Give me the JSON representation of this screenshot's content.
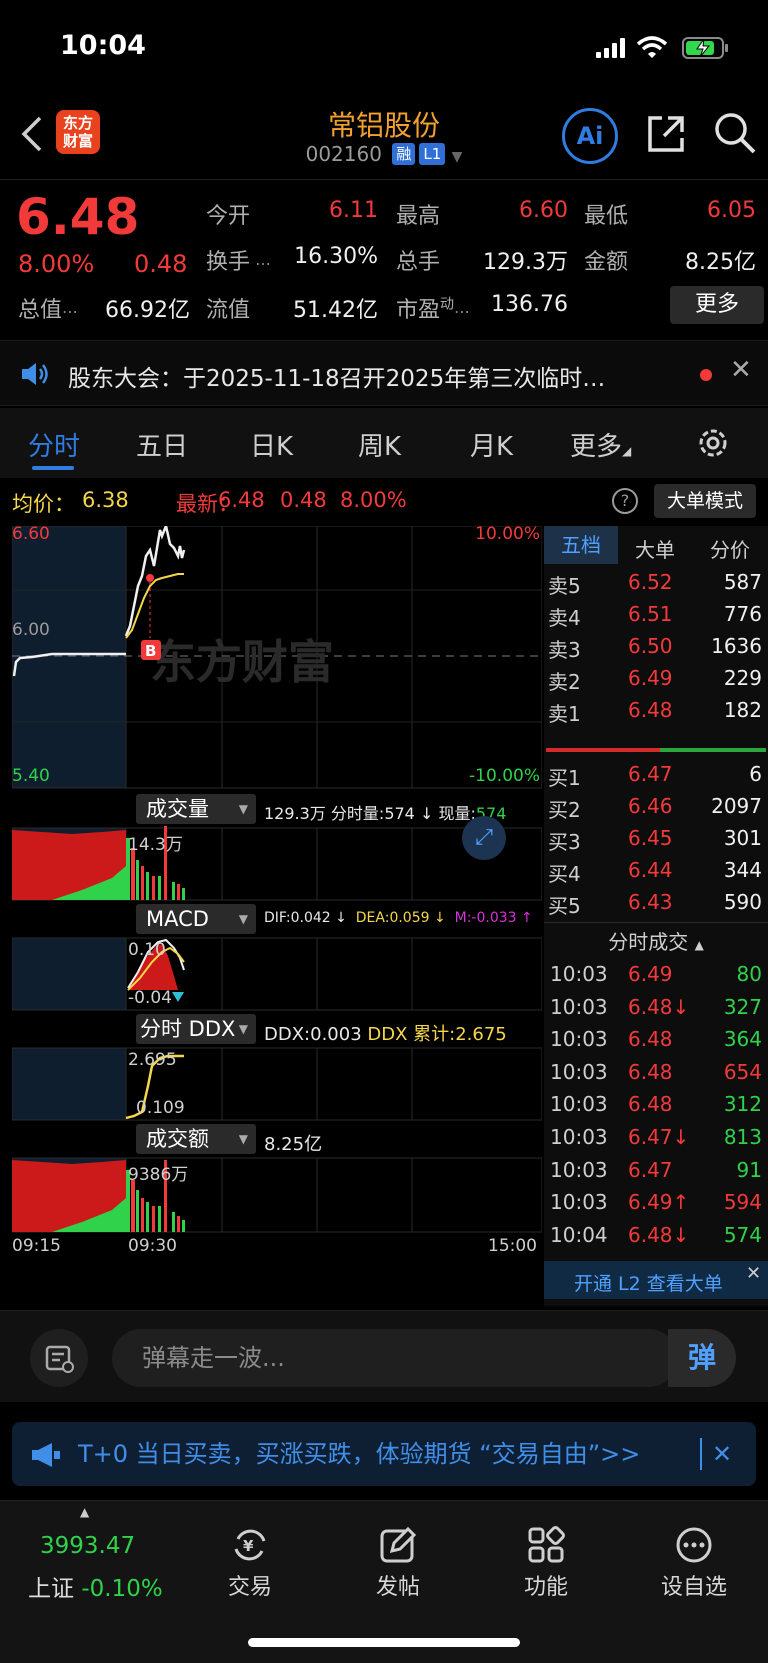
{
  "status_bar": {
    "time": "10:04"
  },
  "nav": {
    "logo_text": "东方财富",
    "stock_name": "常铝股份",
    "stock_code": "002160",
    "tag_margin": "融",
    "tag_level": "L1",
    "ai_label": "Ai"
  },
  "quote": {
    "price": "6.48",
    "change_pct": "8.00%",
    "change": "0.48",
    "open_label": "今开",
    "open": "6.11",
    "high_label": "最高",
    "high": "6.60",
    "low_label": "最低",
    "low": "6.05",
    "turnover_label": "换手",
    "turnover": "16.30%",
    "volume_label": "总手",
    "volume": "129.3万",
    "amount_label": "金额",
    "amount": "8.25亿",
    "mktcap_label": "总值",
    "mktcap": "66.92亿",
    "float_label": "流值",
    "float": "51.42亿",
    "pe_label": "市盈",
    "pe_sup": "动",
    "pe": "136.76",
    "more_btn": "更多"
  },
  "notice": {
    "text": "股东大会：于2025-11-18召开2025年第三次临时…"
  },
  "tabs": [
    "分时",
    "五日",
    "日K",
    "周K",
    "月K",
    "更多"
  ],
  "infobar": {
    "avg_label": "均价：",
    "avg": "6.38",
    "latest_label": "最新：",
    "latest": "6.48",
    "latest_chg": "0.48",
    "latest_pct": "8.00%",
    "bigorder_btn": "大单模式"
  },
  "chart": {
    "price_top": "6.60",
    "price_mid": "6.00",
    "price_bottom": "5.40",
    "pct_top": "10.00%",
    "pct_bottom": "-10.00%",
    "watermark": "东方财富",
    "b_marker": "B",
    "vol_label": "成交量",
    "vol_total": "129.3万",
    "vol_min_label": "分时量:",
    "vol_min": "574 ↓",
    "vol_now_label": "现量:",
    "vol_now": "574",
    "vol_scale": "14.3万",
    "macd_label": "MACD",
    "dif": "DIF:0.042 ↓",
    "dea": "DEA:0.059 ↓",
    "m": "M:-0.033 ↑",
    "macd_top": "0.10",
    "macd_bottom": "-0.04",
    "ddx_label": "分时 DDX",
    "ddx": "DDX:0.003",
    "ddx_sum": "DDX 累计:2.675",
    "ddx_top": "2.695",
    "ddx_bottom": "0.109",
    "amt_label": "成交额",
    "amt_total": "8.25亿",
    "amt_scale": "9386万",
    "time_start": "09:15",
    "time_open": "09:30",
    "time_end": "15:00"
  },
  "book": {
    "tabs": [
      "五档",
      "大单",
      "分价"
    ],
    "asks": [
      {
        "label": "卖5",
        "price": "6.52",
        "vol": "587"
      },
      {
        "label": "卖4",
        "price": "6.51",
        "vol": "776"
      },
      {
        "label": "卖3",
        "price": "6.50",
        "vol": "1636"
      },
      {
        "label": "卖2",
        "price": "6.49",
        "vol": "229"
      },
      {
        "label": "卖1",
        "price": "6.48",
        "vol": "182"
      }
    ],
    "bids": [
      {
        "label": "买1",
        "price": "6.47",
        "vol": "6"
      },
      {
        "label": "买2",
        "price": "6.46",
        "vol": "2097"
      },
      {
        "label": "买3",
        "price": "6.45",
        "vol": "301"
      },
      {
        "label": "买4",
        "price": "6.44",
        "vol": "344"
      },
      {
        "label": "买5",
        "price": "6.43",
        "vol": "590"
      }
    ],
    "trades_title": "分时成交",
    "trades": [
      {
        "time": "10:03",
        "price": "6.49",
        "vol": "80",
        "pc": "red",
        "vc": "green"
      },
      {
        "time": "10:03",
        "price": "6.48↓",
        "vol": "327",
        "pc": "red",
        "vc": "green"
      },
      {
        "time": "10:03",
        "price": "6.48",
        "vol": "364",
        "pc": "red",
        "vc": "green"
      },
      {
        "time": "10:03",
        "price": "6.48",
        "vol": "654",
        "pc": "red",
        "vc": "red"
      },
      {
        "time": "10:03",
        "price": "6.48",
        "vol": "312",
        "pc": "red",
        "vc": "green"
      },
      {
        "time": "10:03",
        "price": "6.47↓",
        "vol": "813",
        "pc": "red",
        "vc": "green"
      },
      {
        "time": "10:03",
        "price": "6.47",
        "vol": "91",
        "pc": "red",
        "vc": "green"
      },
      {
        "time": "10:03",
        "price": "6.49↑",
        "vol": "594",
        "pc": "red",
        "vc": "red"
      },
      {
        "time": "10:04",
        "price": "6.48↓",
        "vol": "574",
        "pc": "red",
        "vc": "green"
      }
    ],
    "l2_text": "开通 L2 查看大单"
  },
  "comment": {
    "placeholder": "弹幕走一波...",
    "danmu_btn": "弹"
  },
  "promo": {
    "text": "T+0 当日买卖，买涨买跌，体验期货 “交易自由”>>"
  },
  "bottom": {
    "index_value": "3993.47",
    "index_name": "上证",
    "index_chg": "-0.10%",
    "items": [
      "交易",
      "发帖",
      "功能",
      "设自选"
    ]
  },
  "colors": {
    "up": "#f23a3a",
    "down": "#2fd24a",
    "accent": "#2f7de0",
    "title": "#f2a12f"
  }
}
